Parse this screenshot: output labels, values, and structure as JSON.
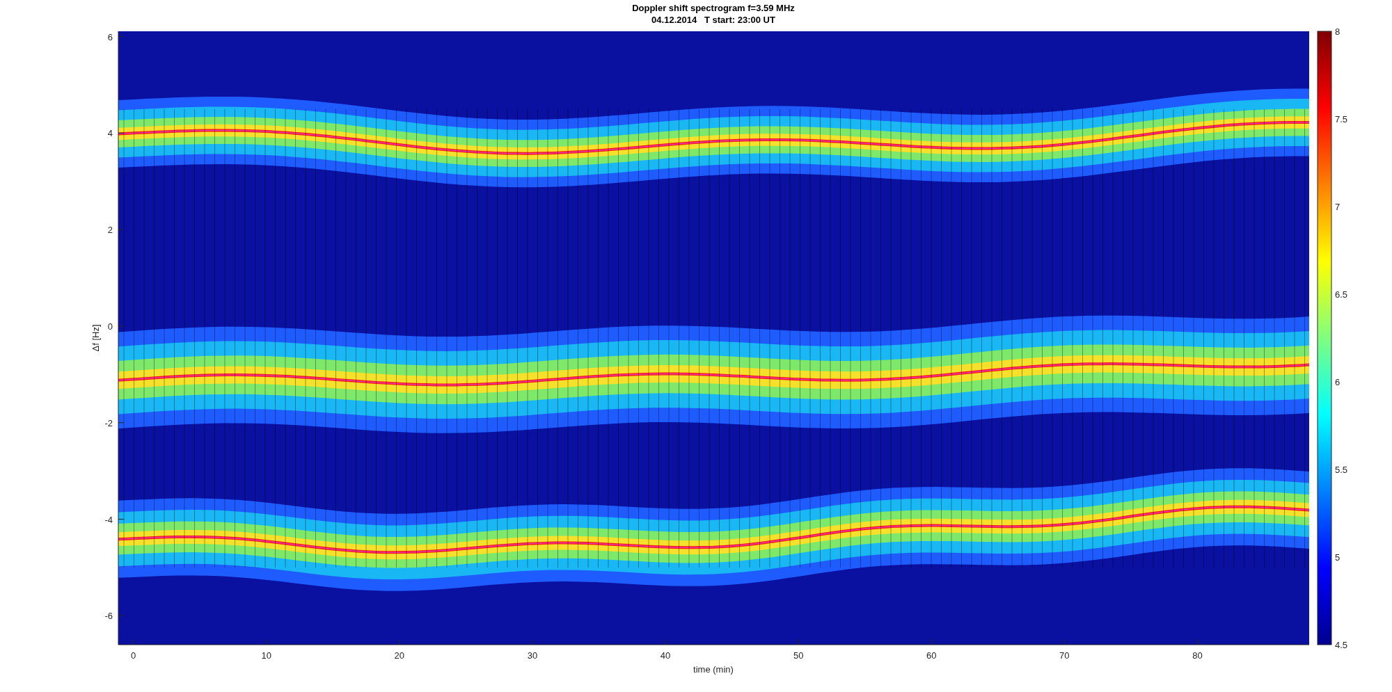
{
  "title": [
    "Doppler shift spectrogram f=3.59 MHz",
    "04.12.2014   T start: 23:00 UT"
  ],
  "x_axis": {
    "label": "time (min)",
    "ticks": [
      "0",
      "10",
      "20",
      "30",
      "40",
      "50",
      "60",
      "70",
      "80"
    ]
  },
  "y_axis": {
    "label": "Δf [Hz]",
    "ticks": [
      "6",
      "4",
      "2",
      "0",
      "-2",
      "-4",
      "-6"
    ]
  },
  "colorbar": {
    "ticks": [
      "8",
      "7.5",
      "7",
      "6.5",
      "6",
      "5.5",
      "5",
      "4.5"
    ]
  }
}
